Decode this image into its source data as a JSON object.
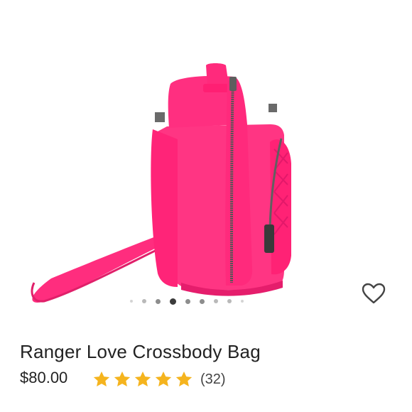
{
  "product": {
    "title": "Ranger Love Crossbody Bag",
    "price": "$80.00",
    "rating_value": 5,
    "rating_max": 5,
    "review_count": "(32)"
  },
  "gallery": {
    "image_count": 9,
    "active_index": 3
  },
  "icons": {
    "wishlist": "heart-outline-icon",
    "star": "star-icon"
  },
  "colors": {
    "bag": "#ff2d7e",
    "star": "#f5b41e"
  }
}
